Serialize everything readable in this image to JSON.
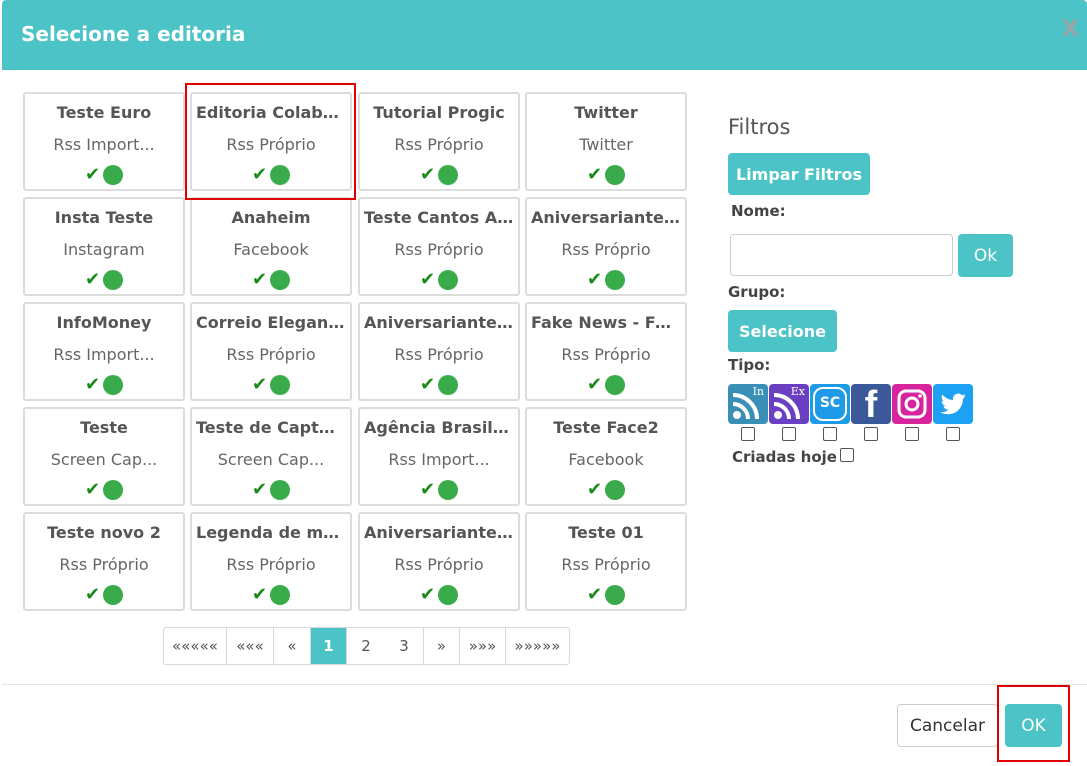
{
  "dialog": {
    "title": "Selecione a editoria",
    "close_label": "X"
  },
  "cards": [
    {
      "title": "Teste Euro",
      "type": "Rss Import...",
      "check": "✔"
    },
    {
      "title": "Editoria Colabo...",
      "type": "Rss Próprio",
      "check": "✔"
    },
    {
      "title": "Tutorial Progic",
      "type": "Rss Próprio",
      "check": "✔"
    },
    {
      "title": "Twitter",
      "type": "Twitter",
      "check": "✔"
    },
    {
      "title": "Insta Teste",
      "type": "Instagram",
      "check": "✔"
    },
    {
      "title": "Anaheim",
      "type": "Facebook",
      "check": "✔"
    },
    {
      "title": "Teste Cantos Ar...",
      "type": "Rss Próprio",
      "check": "✔"
    },
    {
      "title": "Aniversariantes...",
      "type": "Rss Próprio",
      "check": "✔"
    },
    {
      "title": "InfoMoney",
      "type": "Rss Import...",
      "check": "✔"
    },
    {
      "title": "Correio Elegant...",
      "type": "Rss Próprio",
      "check": "✔"
    },
    {
      "title": "Aniversariantes...",
      "type": "Rss Próprio",
      "check": "✔"
    },
    {
      "title": "Fake News - Fe...",
      "type": "Rss Próprio",
      "check": "✔"
    },
    {
      "title": "Teste",
      "type": "Screen Cap...",
      "check": "✔"
    },
    {
      "title": "Teste de Captur...",
      "type": "Screen Cap...",
      "check": "✔"
    },
    {
      "title": "Agência Brasil - ...",
      "type": "Rss Import...",
      "check": "✔"
    },
    {
      "title": "Teste Face2",
      "type": "Facebook",
      "check": "✔"
    },
    {
      "title": "Teste novo 2",
      "type": "Rss Próprio",
      "check": "✔"
    },
    {
      "title": "Legenda de mol...",
      "type": "Rss Próprio",
      "check": "✔"
    },
    {
      "title": "Aniversariantes...",
      "type": "Rss Próprio",
      "check": "✔"
    },
    {
      "title": "Teste 01",
      "type": "Rss Próprio",
      "check": "✔"
    }
  ],
  "pagination": {
    "first": "«««««",
    "prev_many": "«««",
    "prev": "«",
    "pages": [
      "1",
      "2",
      "3"
    ],
    "active_page": "1",
    "next": "»",
    "next_many": "»»»",
    "last": "»»»»»"
  },
  "filters": {
    "title": "Filtros",
    "clear_label": "Limpar Filtros",
    "name_label": "Nome:",
    "name_value": "",
    "name_ok_label": "Ok",
    "group_label": "Grupo:",
    "group_select_label": "Selecione",
    "type_label": "Tipo:",
    "type_icons": [
      {
        "icon": "rss-import-icon",
        "badge": "In",
        "color": "#3a8fb7"
      },
      {
        "icon": "rss-external-icon",
        "badge": "Ex",
        "color": "#6a3fc1"
      },
      {
        "icon": "screen-capture-icon",
        "badge": "SC",
        "color": "#1e9be8"
      },
      {
        "icon": "facebook-icon",
        "badge": "f",
        "color": "#3b5998"
      },
      {
        "icon": "instagram-icon",
        "badge": "",
        "color": "#d6249f"
      },
      {
        "icon": "twitter-icon",
        "badge": "",
        "color": "#1da1f2"
      }
    ],
    "created_today_label": "Criadas hoje"
  },
  "footer": {
    "cancel_label": "Cancelar",
    "ok_label": "OK"
  },
  "colors": {
    "accent": "#4cc3c6",
    "status_green": "#3aab4a",
    "check_green": "#1a8a1a",
    "highlight_red": "#e00000"
  }
}
